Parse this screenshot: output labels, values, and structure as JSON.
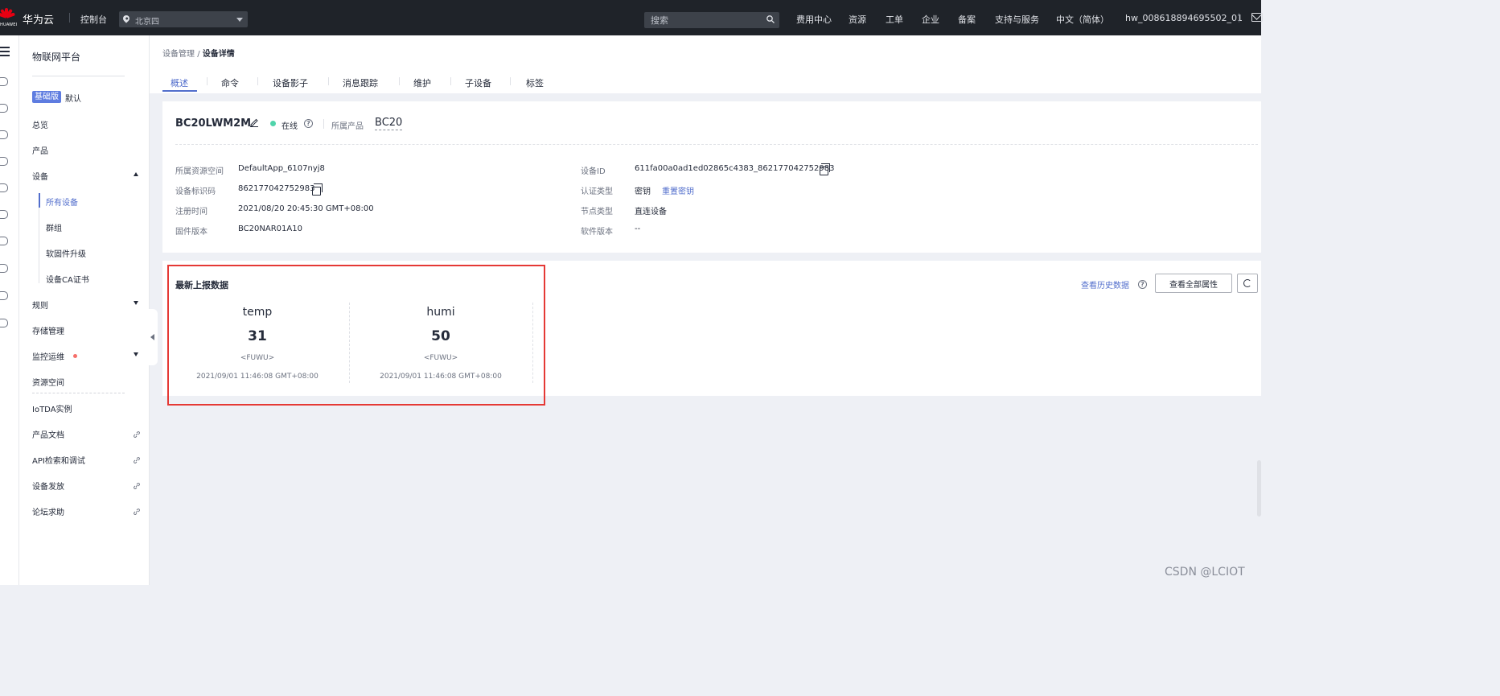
{
  "topbar": {
    "logo_sub": "HUAWEI",
    "brand": "华为云",
    "console": "控制台",
    "region": "北京四",
    "search_placeholder": "搜索",
    "links": [
      "费用中心",
      "资源",
      "工单",
      "企业",
      "备案",
      "支持与服务",
      "中文（简体）",
      "hw_008618894695502_01"
    ],
    "icons": [
      "menu-icon",
      "location-pin-icon",
      "search-icon",
      "mail-icon"
    ]
  },
  "nav": {
    "title": "物联网平台",
    "edition_badge": "基础版",
    "edition_default": "默认",
    "items": {
      "overview": "总览",
      "product": "产品",
      "device": "设备",
      "all_devices": "所有设备",
      "group": "群组",
      "firmware": "软固件升级",
      "ca_cert": "设备CA证书",
      "rules": "规则",
      "storage": "存储管理",
      "monitor": "监控运维",
      "resource_space": "资源空间",
      "iotda": "IoTDA实例",
      "docs": "产品文档",
      "api": "API检索和调试",
      "provision": "设备发放",
      "forum": "论坛求助"
    }
  },
  "breadcrumb": {
    "parent": "设备管理",
    "separator": "/",
    "current": "设备详情"
  },
  "tabs": [
    "概述",
    "命令",
    "设备影子",
    "消息跟踪",
    "维护",
    "子设备",
    "标签"
  ],
  "device": {
    "name": "BC20LWM2M",
    "status": "在线",
    "product_label": "所属产品",
    "product": "BC20",
    "fields_left": [
      {
        "label": "所属资源空间",
        "value": "DefaultApp_6107nyj8"
      },
      {
        "label": "设备标识码",
        "value": "862177042752983"
      },
      {
        "label": "注册时间",
        "value": "2021/08/20 20:45:30 GMT+08:00"
      },
      {
        "label": "固件版本",
        "value": "BC20NAR01A10"
      }
    ],
    "fields_right": [
      {
        "label": "设备ID",
        "value": "611fa00a0ad1ed02865c4383_862177042752983"
      },
      {
        "label": "认证类型",
        "value": "密钥",
        "action": "重置密钥"
      },
      {
        "label": "节点类型",
        "value": "直连设备"
      },
      {
        "label": "软件版本",
        "value": "--"
      }
    ]
  },
  "latest": {
    "title": "最新上报数据",
    "history_link": "查看历史数据",
    "all_props_button": "查看全部属性",
    "properties": [
      {
        "name": "temp",
        "value": "31",
        "service": "<FUWU>",
        "time": "2021/09/01 11:46:08 GMT+08:00"
      },
      {
        "name": "humi",
        "value": "50",
        "service": "<FUWU>",
        "time": "2021/09/01 11:46:08 GMT+08:00"
      }
    ]
  },
  "watermark": "CSDN @LCIOT",
  "colors": {
    "topbar_bg": "#1f2329",
    "accent": "#526ecc",
    "online": "#50d4ab",
    "highlight_border": "#e53935",
    "brand_red": "#e60012"
  }
}
